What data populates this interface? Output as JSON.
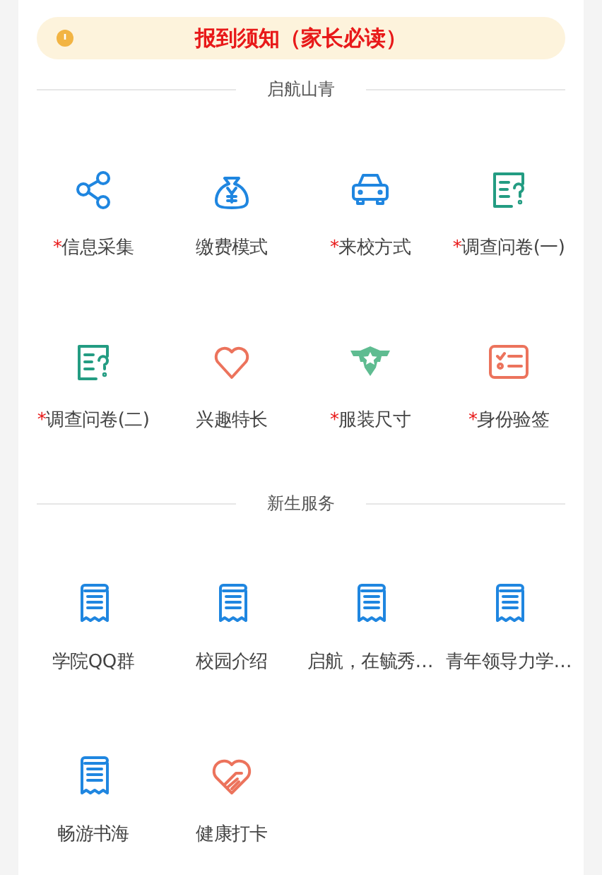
{
  "notice": {
    "text": "报到须知（家长必读）"
  },
  "sections": [
    {
      "title": "启航山青",
      "items": [
        {
          "label": "信息采集",
          "required_mark": "*",
          "kind": "share",
          "color": "#1f86e0"
        },
        {
          "label": "缴费模式",
          "kind": "moneybag",
          "color": "#1f86e0"
        },
        {
          "label": "来校方式",
          "required_mark": "*",
          "kind": "car",
          "color": "#1f86e0"
        },
        {
          "label": "调查问卷(一)",
          "required_mark": "*",
          "kind": "survey",
          "color": "#239c82"
        },
        {
          "label": "调查问卷(二)",
          "required_mark": "*",
          "kind": "survey",
          "color": "#239c82"
        },
        {
          "label": "兴趣特长",
          "kind": "heart",
          "color": "#ec735c"
        },
        {
          "label": "服装尺寸",
          "required_mark": "*",
          "kind": "badge",
          "color": "#5fbc91"
        },
        {
          "label": "身份验签",
          "required_mark": "*",
          "kind": "checklist",
          "color": "#ec735c"
        }
      ]
    },
    {
      "title": "新生服务",
      "items": [
        {
          "label": "学院QQ群",
          "kind": "receipt",
          "color": "#1f86e0"
        },
        {
          "label": "校园介绍",
          "kind": "receipt",
          "color": "#1f86e0"
        },
        {
          "label": "启航，在毓秀…",
          "kind": "receipt",
          "color": "#1f86e0"
        },
        {
          "label": "青年领导力学…",
          "kind": "receipt",
          "color": "#1f86e0"
        },
        {
          "label": "畅游书海",
          "kind": "receipt",
          "color": "#1f86e0"
        },
        {
          "label": "健康打卡",
          "kind": "handheart",
          "color": "#ec735c"
        }
      ]
    }
  ]
}
